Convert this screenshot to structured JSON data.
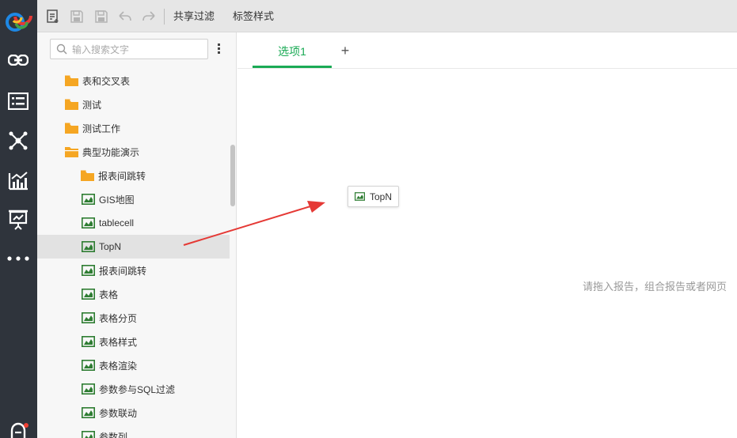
{
  "toolbar": {
    "share_filter_label": "共享过滤",
    "tag_style_label": "标签样式"
  },
  "rail": {
    "icons": [
      "link-icon",
      "list-icon",
      "network-icon",
      "analysis-chart-icon",
      "presentation-icon",
      "more-icon",
      "user-icon"
    ],
    "accent": "#f04134"
  },
  "sidebar": {
    "search": {
      "placeholder": "输入搜索文字",
      "value": ""
    },
    "items": [
      {
        "label": "表和交叉表",
        "type": "folder"
      },
      {
        "label": "测试",
        "type": "folder"
      },
      {
        "label": "测试工作",
        "type": "folder"
      },
      {
        "label": "典型功能演示",
        "type": "folder-open"
      },
      {
        "label": "报表间跳转",
        "type": "folder"
      },
      {
        "label": "GIS地图",
        "type": "report"
      },
      {
        "label": "tablecell",
        "type": "report"
      },
      {
        "label": "TopN",
        "type": "report",
        "selected": true
      },
      {
        "label": "报表间跳转",
        "type": "report"
      },
      {
        "label": "表格",
        "type": "report"
      },
      {
        "label": "表格分页",
        "type": "report"
      },
      {
        "label": "表格样式",
        "type": "report"
      },
      {
        "label": "表格渲染",
        "type": "report"
      },
      {
        "label": "参数参与SQL过滤",
        "type": "report"
      },
      {
        "label": "参数联动",
        "type": "report"
      },
      {
        "label": "参数列",
        "type": "report"
      }
    ]
  },
  "main": {
    "tabs": [
      {
        "label": "选项1"
      }
    ],
    "add_tab_label": "+",
    "drag_chip_label": "TopN",
    "hint": "请拖入报告，组合报告或者网页"
  },
  "colors": {
    "accent_green": "#1aaa55",
    "folder_orange": "#f5a623",
    "report_green": "#2e7d32",
    "arrow_red": "#e53935",
    "rail_bg": "#2f343c"
  }
}
